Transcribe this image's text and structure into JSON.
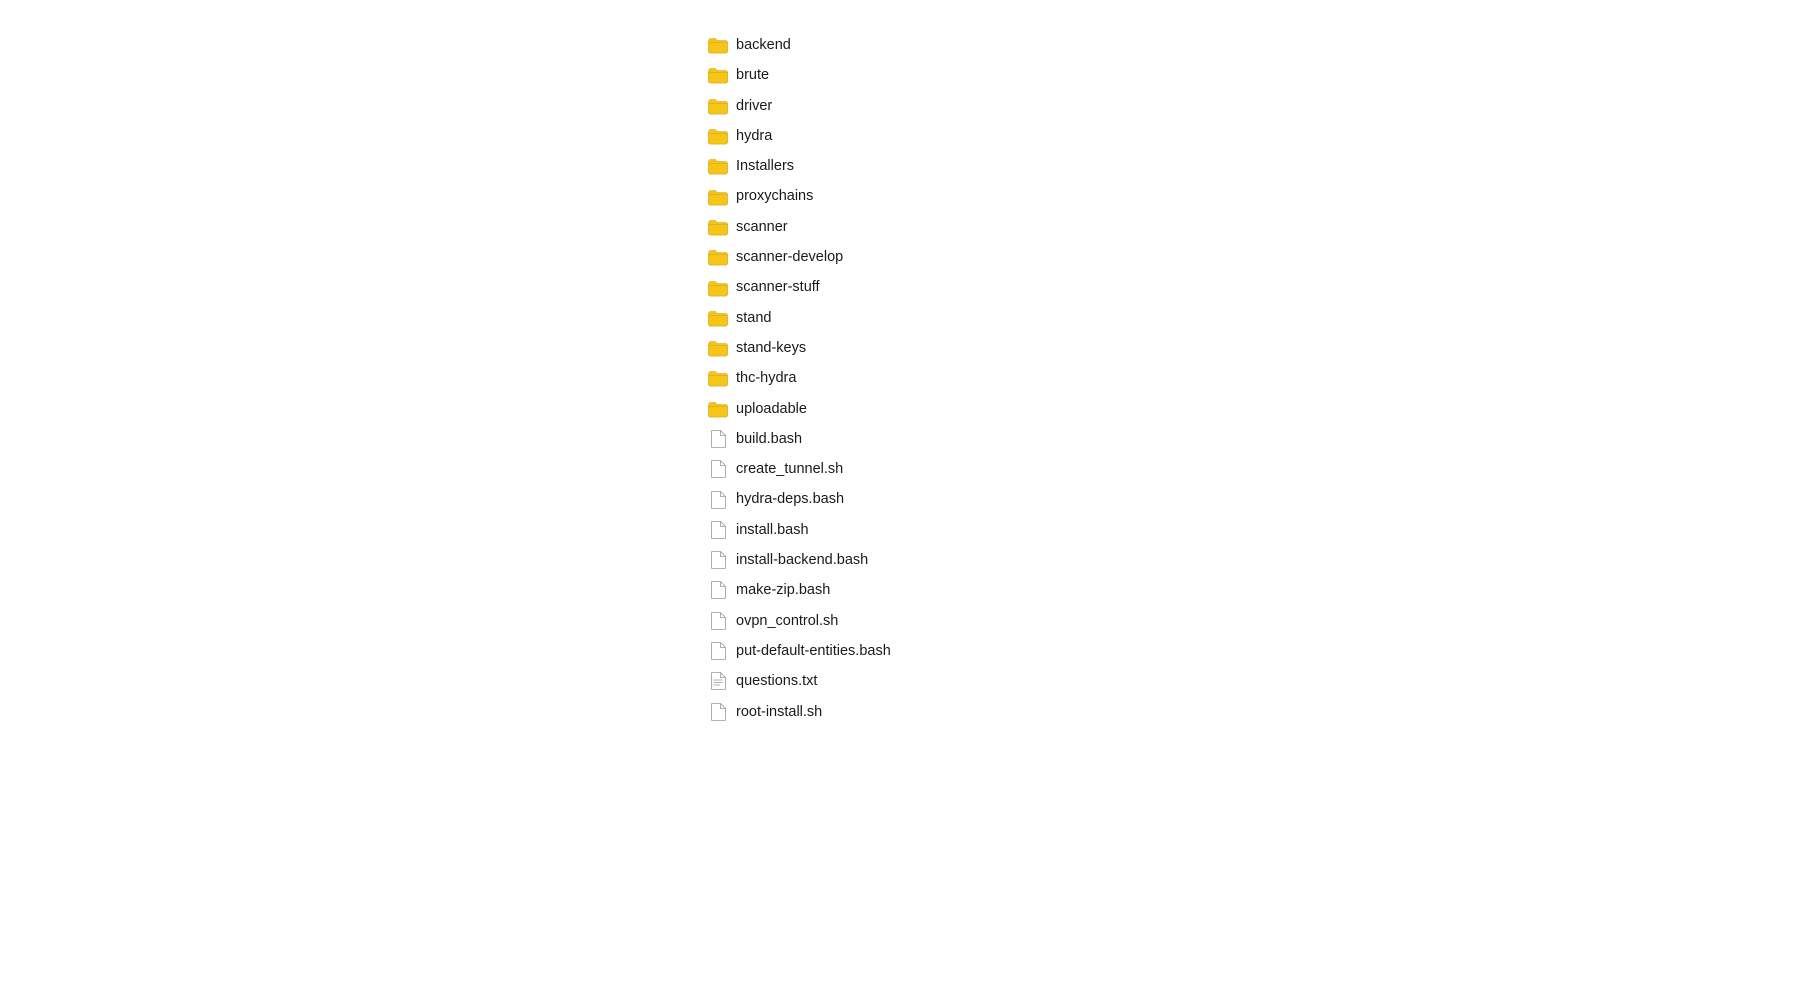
{
  "fileList": {
    "items": [
      {
        "name": "backend",
        "type": "folder"
      },
      {
        "name": "brute",
        "type": "folder"
      },
      {
        "name": "driver",
        "type": "folder"
      },
      {
        "name": "hydra",
        "type": "folder"
      },
      {
        "name": "Installers",
        "type": "folder"
      },
      {
        "name": "proxychains",
        "type": "folder"
      },
      {
        "name": "scanner",
        "type": "folder"
      },
      {
        "name": "scanner-develop",
        "type": "folder"
      },
      {
        "name": "scanner-stuff",
        "type": "folder"
      },
      {
        "name": "stand",
        "type": "folder"
      },
      {
        "name": "stand-keys",
        "type": "folder"
      },
      {
        "name": "thc-hydra",
        "type": "folder"
      },
      {
        "name": "uploadable",
        "type": "folder"
      },
      {
        "name": "build.bash",
        "type": "file"
      },
      {
        "name": "create_tunnel.sh",
        "type": "file"
      },
      {
        "name": "hydra-deps.bash",
        "type": "file"
      },
      {
        "name": "install.bash",
        "type": "file"
      },
      {
        "name": "install-backend.bash",
        "type": "file"
      },
      {
        "name": "make-zip.bash",
        "type": "file"
      },
      {
        "name": "ovpn_control.sh",
        "type": "file"
      },
      {
        "name": "put-default-entities.bash",
        "type": "file"
      },
      {
        "name": "questions.txt",
        "type": "txt"
      },
      {
        "name": "root-install.sh",
        "type": "file"
      }
    ]
  }
}
